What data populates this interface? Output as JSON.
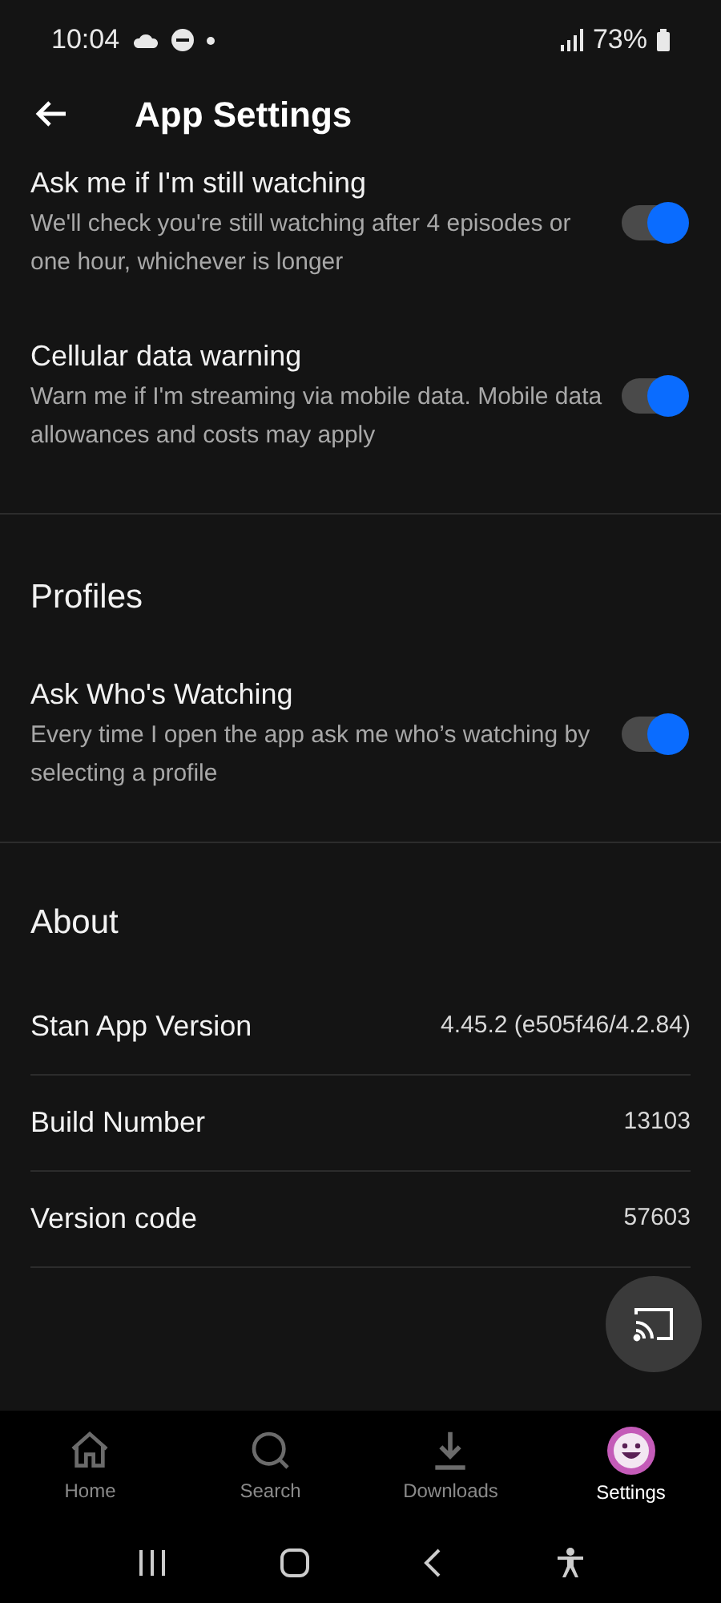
{
  "status_bar": {
    "time": "10:04",
    "battery": "73%"
  },
  "header": {
    "title": "App Settings"
  },
  "toggles": [
    {
      "title": "Ask me if I'm still watching",
      "description": "We'll check you're still watching after 4 episodes or one hour, whichever is longer",
      "on": true
    },
    {
      "title": "Cellular data warning",
      "description": "Warn me if I'm streaming via mobile data. Mobile data allowances and costs may apply",
      "on": true
    }
  ],
  "profiles": {
    "heading": "Profiles",
    "toggles": [
      {
        "title": "Ask Who's Watching",
        "description": "Every time I open the app ask me who’s watching by selecting a profile",
        "on": true
      }
    ]
  },
  "about": {
    "heading": "About",
    "rows": [
      {
        "label": "Stan App Version",
        "value": "4.45.2 (e505f46/4.2.84)"
      },
      {
        "label": "Build Number",
        "value": "13103"
      },
      {
        "label": "Version code",
        "value": "57603"
      }
    ]
  },
  "bottom_nav": [
    {
      "kind": "home",
      "label": "Home",
      "selected": false
    },
    {
      "kind": "search",
      "label": "Search",
      "selected": false
    },
    {
      "kind": "downloads",
      "label": "Downloads",
      "selected": false
    },
    {
      "kind": "avatar",
      "label": "Settings",
      "selected": true
    }
  ]
}
